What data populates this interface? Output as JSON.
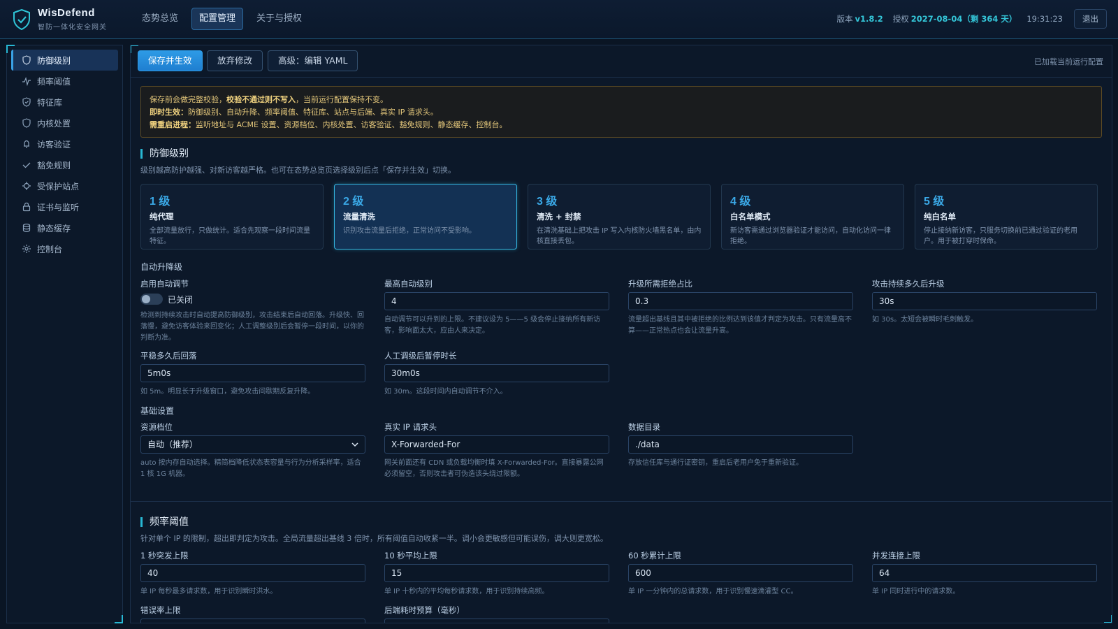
{
  "brand": {
    "name": "WisDefend",
    "subtitle": "智防一体化安全网关"
  },
  "nav": {
    "items": [
      "态势总览",
      "配置管理",
      "关于与授权"
    ],
    "active_index": 1
  },
  "header": {
    "version_label": "版本",
    "version": "v1.8.2",
    "license_label": "授权",
    "license": "2027-08-04（剩 364 天）",
    "clock": "19:31:23",
    "logout": "退出"
  },
  "sidebar": {
    "items": [
      {
        "label": "防御级别",
        "icon": "shield-icon"
      },
      {
        "label": "频率阈值",
        "icon": "pulse-icon"
      },
      {
        "label": "特征库",
        "icon": "shield-check-icon"
      },
      {
        "label": "内核处置",
        "icon": "shield-icon"
      },
      {
        "label": "访客验证",
        "icon": "bell-icon"
      },
      {
        "label": "豁免规则",
        "icon": "check-icon"
      },
      {
        "label": "受保护站点",
        "icon": "crosshair-icon"
      },
      {
        "label": "证书与监听",
        "icon": "lock-icon"
      },
      {
        "label": "静态缓存",
        "icon": "database-icon"
      },
      {
        "label": "控制台",
        "icon": "gear-icon"
      }
    ],
    "active_index": 0
  },
  "toolbar": {
    "save": "保存并生效",
    "discard": "放弃修改",
    "yaml": "高级：编辑 YAML",
    "loaded": "已加载当前运行配置"
  },
  "notice": {
    "l1a": "保存前会做完整校验，",
    "l1b": "校验不通过则不写入",
    "l1c": "，当前运行配置保持不变。",
    "l2a": "即时生效：",
    "l2b": "防御级别、自动升降、频率阈值、特征库、站点与后端、真实 IP 请求头。",
    "l3a": "需重启进程：",
    "l3b": "监听地址与 ACME 设置、资源档位、内核处置、访客验证、豁免规则、静态缓存、控制台。"
  },
  "defense": {
    "title": "防御级别",
    "desc": "级别越高防护越强、对新访客越严格。也可在态势总览页选择级别后点「保存并生效」切换。",
    "levels": [
      {
        "num": "1 级",
        "name": "纯代理",
        "desc": "全部流量放行，只做统计。适合先观察一段时间流量特征。"
      },
      {
        "num": "2 级",
        "name": "流量清洗",
        "desc": "识别攻击流量后拒绝，正常访问不受影响。"
      },
      {
        "num": "3 级",
        "name": "清洗 + 封禁",
        "desc": "在清洗基础上把攻击 IP 写入内核防火墙黑名单，由内核直接丢包。"
      },
      {
        "num": "4 级",
        "name": "白名单模式",
        "desc": "新访客需通过浏览器验证才能访问，自动化访问一律拒绝。"
      },
      {
        "num": "5 级",
        "name": "纯白名单",
        "desc": "停止接纳新访客，只服务切换前已通过验证的老用户。用于被打穿时保命。"
      }
    ],
    "active_level": 2
  },
  "auto": {
    "title": "自动升降级",
    "enable": {
      "label": "启用自动调节",
      "state": "已关闭",
      "on": false,
      "help": "检测到持续攻击时自动提高防御级别，攻击结束后自动回落。升级快、回落慢，避免访客体验来回变化；人工调整级别后会暂停一段时间，以你的判断为准。"
    },
    "max_level": {
      "label": "最高自动级别",
      "value": "4",
      "help": "自动调节可以升到的上限。不建议设为 5——5 级会停止接纳所有新访客，影响面太大，应由人来决定。"
    },
    "ratio": {
      "label": "升级所需拒绝占比",
      "value": "0.3",
      "help": "流量超出基线且其中被拒绝的比例达到该值才判定为攻击。只有流量高不算——正常热点也会让流量升高。"
    },
    "duration": {
      "label": "攻击持续多久后升级",
      "value": "30s",
      "help": "如 30s。太短会被瞬时毛刺触发。"
    },
    "calm": {
      "label": "平稳多久后回落",
      "value": "5m0s",
      "help": "如 5m。明显长于升级窗口，避免攻击间歇期反复升降。"
    },
    "pause": {
      "label": "人工调级后暂停时长",
      "value": "30m0s",
      "help": "如 30m。这段时间内自动调节不介入。"
    }
  },
  "basic": {
    "title": "基础设置",
    "profile": {
      "label": "资源档位",
      "value": "自动（推荐）",
      "help": "auto 按内存自动选择。精简档降低状态表容量与行为分析采样率，适合 1 核 1G 机器。"
    },
    "real_ip": {
      "label": "真实 IP 请求头",
      "value": "X-Forwarded-For",
      "help": "网关前面还有 CDN 或负载均衡时填 X-Forwarded-For。直接暴露公网必须留空，否则攻击者可伪造该头绕过限额。"
    },
    "data_dir": {
      "label": "数据目录",
      "value": "./data",
      "help": "存放信任库与通行证密钥，重启后老用户免于重新验证。"
    }
  },
  "rate": {
    "title": "频率阈值",
    "desc": "针对单个 IP 的限制，超出即判定为攻击。全局流量超出基线 3 倍时，所有阈值自动收紧一半。调小会更敏感但可能误伤，调大则更宽松。",
    "burst": {
      "label": "1 秒突发上限",
      "value": "40",
      "help": "单 IP 每秒最多请求数，用于识别瞬时洪水。"
    },
    "avg10": {
      "label": "10 秒平均上限",
      "value": "15",
      "help": "单 IP 十秒内的平均每秒请求数，用于识别持续高频。"
    },
    "sum60": {
      "label": "60 秒累计上限",
      "value": "600",
      "help": "单 IP 一分钟内的总请求数，用于识别慢速滴灌型 CC。"
    },
    "conc": {
      "label": "并发连接上限",
      "value": "64",
      "help": "单 IP 同时进行中的请求数。"
    },
    "err": {
      "label": "错误率上限"
    },
    "backend": {
      "label": "后端耗时预算（毫秒）"
    }
  }
}
